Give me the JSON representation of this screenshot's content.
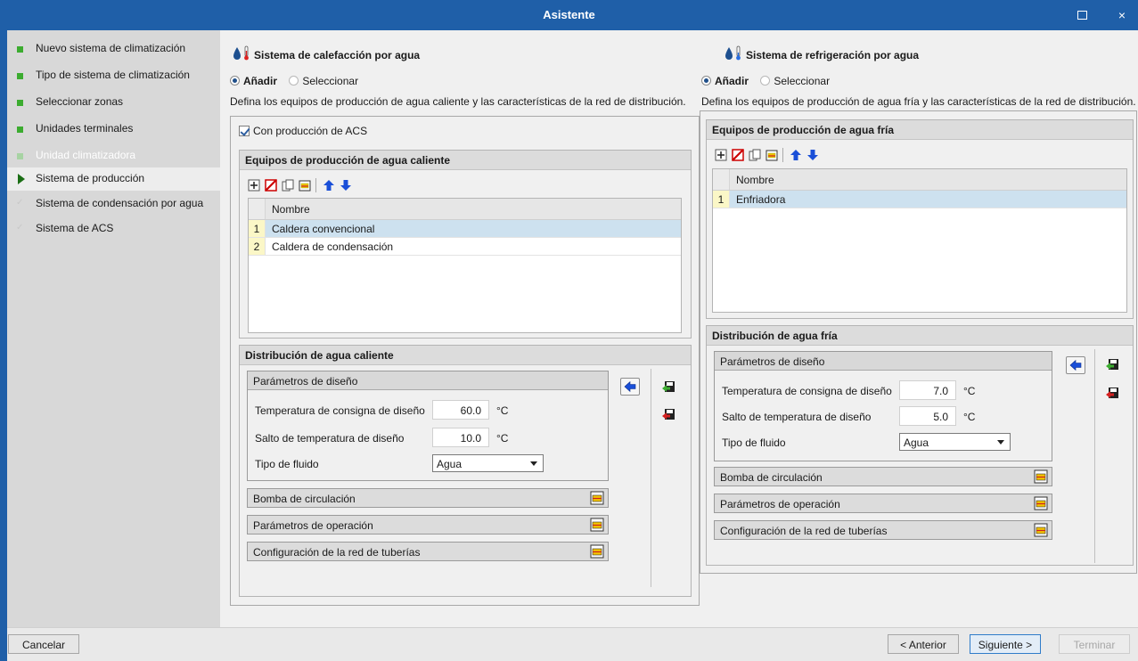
{
  "window": {
    "title": "Asistente",
    "maximize_label": "",
    "close_label": "×"
  },
  "sidebar": {
    "items": [
      {
        "label": "Nuevo sistema de climatización",
        "state": "done"
      },
      {
        "label": "Tipo de sistema de climatización",
        "state": "done"
      },
      {
        "label": "Seleccionar zonas",
        "state": "done"
      },
      {
        "label": "Unidades terminales",
        "state": "done"
      },
      {
        "label": "Unidad climatizadora",
        "state": "disabled"
      },
      {
        "label": "Sistema de producción",
        "state": "active"
      },
      {
        "label": "Sistema de condensación por agua",
        "state": "pending"
      },
      {
        "label": "Sistema de ACS",
        "state": "pending"
      }
    ]
  },
  "heating": {
    "title": "Sistema de calefacción por agua",
    "radio_add": "Añadir",
    "radio_select": "Seleccionar",
    "description": "Defina los equipos de producción de agua caliente y las características de la red de distribución.",
    "acs_checkbox": "Con producción de ACS",
    "acs_checked": true,
    "equipment_title": "Equipos de producción de agua caliente",
    "table_header": "Nombre",
    "rows": [
      {
        "num": "1",
        "name": "Caldera convencional",
        "selected": true
      },
      {
        "num": "2",
        "name": "Caldera de condensación",
        "selected": false
      }
    ],
    "distribution_title": "Distribución de agua caliente",
    "design_params_title": "Parámetros de diseño",
    "setpoint_label": "Temperatura de consigna de diseño",
    "setpoint_value": "60.0",
    "delta_label": "Salto de temperatura de diseño",
    "delta_value": "10.0",
    "unit": "°C",
    "fluid_label": "Tipo de fluido",
    "fluid_value": "Agua",
    "pump_label": "Bomba de circulación",
    "operation_label": "Parámetros de operación",
    "network_label": "Configuración de la red de tuberías"
  },
  "cooling": {
    "title": "Sistema de refrigeración por agua",
    "radio_add": "Añadir",
    "radio_select": "Seleccionar",
    "description": "Defina los equipos de producción de agua fría y las características de la red de distribución.",
    "equipment_title": "Equipos de producción de agua fría",
    "table_header": "Nombre",
    "rows": [
      {
        "num": "1",
        "name": "Enfriadora",
        "selected": true
      }
    ],
    "distribution_title": "Distribución de agua fría",
    "design_params_title": "Parámetros de diseño",
    "setpoint_label": "Temperatura de consigna de diseño",
    "setpoint_value": "7.0",
    "delta_label": "Salto de temperatura de diseño",
    "delta_value": "5.0",
    "unit": "°C",
    "fluid_label": "Tipo de fluido",
    "fluid_value": "Agua",
    "pump_label": "Bomba de circulación",
    "operation_label": "Parámetros de operación",
    "network_label": "Configuración de la red de tuberías"
  },
  "footer": {
    "cancel": "Cancelar",
    "previous": "< Anterior",
    "next": "Siguiente >",
    "finish": "Terminar"
  },
  "colors": {
    "titlebar": "#1f5fa8",
    "accent_green": "#3cac30",
    "selection": "#cde1ef",
    "row_number": "#fbf7c7"
  },
  "icons": [
    "drop-thermometer-icon",
    "add-icon",
    "delete-icon",
    "copy-icon",
    "edit-icon",
    "move-up-icon",
    "move-down-icon",
    "arrow-left-icon",
    "import-icon",
    "export-icon",
    "expand-icon"
  ]
}
